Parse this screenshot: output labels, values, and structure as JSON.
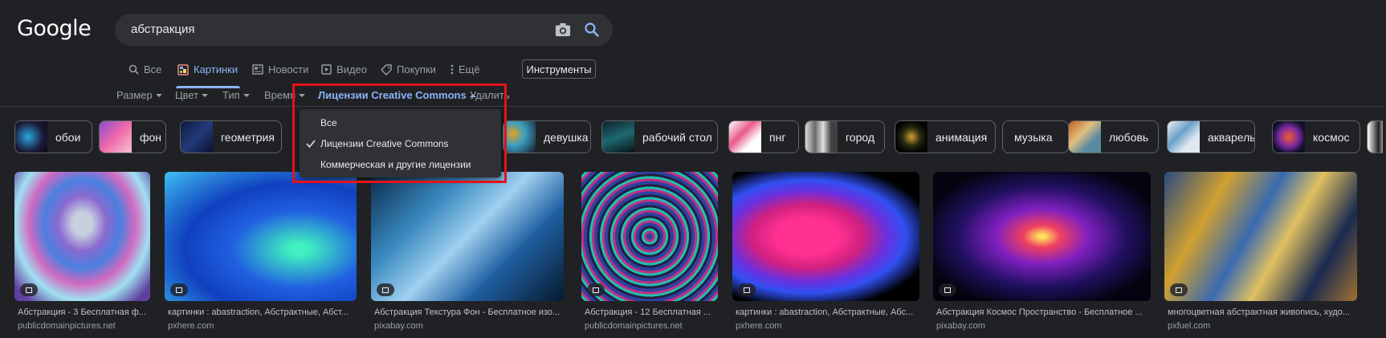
{
  "logo": "Google",
  "search": {
    "query": "абстракция"
  },
  "tabs": [
    {
      "label": "Все",
      "icon": "search-icon"
    },
    {
      "label": "Картинки",
      "icon": "images-icon",
      "active": true
    },
    {
      "label": "Новости",
      "icon": "news-icon"
    },
    {
      "label": "Видео",
      "icon": "video-icon"
    },
    {
      "label": "Покупки",
      "icon": "tag-icon"
    },
    {
      "label": "Ещё",
      "icon": "more-vert-icon"
    }
  ],
  "tools_label": "Инструменты",
  "filters": [
    {
      "label": "Размер"
    },
    {
      "label": "Цвет"
    },
    {
      "label": "Тип"
    },
    {
      "label": "Время"
    },
    {
      "label": "Лицензии Creative Commons",
      "selected": true
    },
    {
      "label": "Удалить"
    }
  ],
  "license_menu": {
    "items": [
      {
        "label": "Все",
        "checked": false
      },
      {
        "label": "Лицензии Creative Commons",
        "checked": true
      },
      {
        "label": "Коммерческая и другие лицензии",
        "checked": false
      }
    ]
  },
  "chips": [
    {
      "label": "обои"
    },
    {
      "label": "фон"
    },
    {
      "label": "геометрия"
    },
    {
      "label": "девушка"
    },
    {
      "label": "рабочий стол"
    },
    {
      "label": "пнг"
    },
    {
      "label": "город"
    },
    {
      "label": "анимация"
    },
    {
      "label": "музыка"
    },
    {
      "label": "любовь"
    },
    {
      "label": "акварель"
    },
    {
      "label": "космос"
    }
  ],
  "results": [
    {
      "title": "Абстракция - 3 Бесплатная ф...",
      "source": "publicdomainpictures.net"
    },
    {
      "title": "картинки : abastraction, Абстрактные, Абст...",
      "source": "pxhere.com"
    },
    {
      "title": "Абстракция Текстура Фон - Бесплатное изо...",
      "source": "pixabay.com"
    },
    {
      "title": "Абстракция - 12 Бесплатная ...",
      "source": "publicdomainpictures.net"
    },
    {
      "title": "картинки : abastraction, Абстрактные, Абс...",
      "source": "pxhere.com"
    },
    {
      "title": "Абстракция Космос Пространство - Бесплатное ...",
      "source": "pixabay.com"
    },
    {
      "title": "многоцветная абстрактная живопись, худо...",
      "source": "pxfuel.com"
    }
  ],
  "colors": {
    "accent": "#8ab4f8",
    "background": "#202124",
    "highlight": "#e3131b"
  }
}
